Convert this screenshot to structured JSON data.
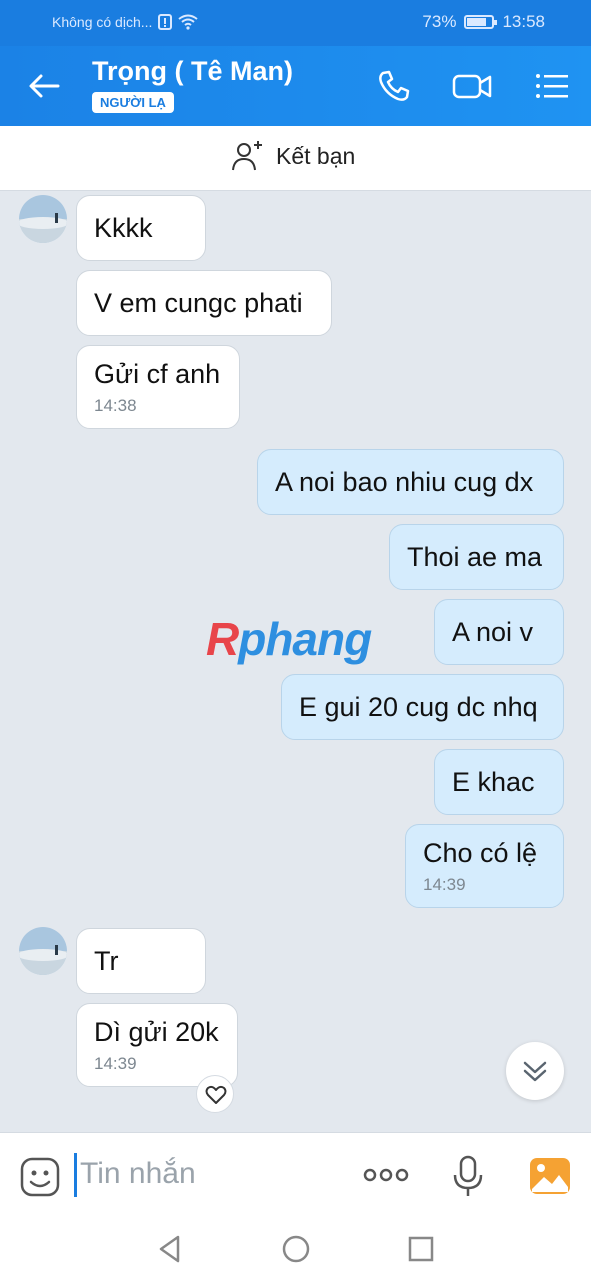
{
  "status_bar": {
    "carrier": "Không có dịch...",
    "battery": "73%",
    "battery_level": 0.73,
    "time": "13:58"
  },
  "header": {
    "title": "Trọng ( Tê Man)",
    "badge": "NGƯỜI LẠ",
    "icons": [
      "back-arrow-icon",
      "phone-icon",
      "video-call-icon",
      "menu-list-icon"
    ]
  },
  "add_friend": {
    "label": "Kết bạn",
    "icon": "add-user-icon"
  },
  "watermark": {
    "r": "R",
    "rest": "phang"
  },
  "messages": [
    {
      "dir": "in",
      "text": "Kkkk",
      "time": ""
    },
    {
      "dir": "in",
      "text": "V em cungc phati",
      "time": ""
    },
    {
      "dir": "in",
      "text": "Gửi cf anh",
      "time": "14:38"
    },
    {
      "dir": "out",
      "text": "A noi bao nhiu cug dx",
      "time": ""
    },
    {
      "dir": "out",
      "text": "Thoi ae ma",
      "time": ""
    },
    {
      "dir": "out",
      "text": "A noi v",
      "time": ""
    },
    {
      "dir": "out",
      "text": "E gui 20 cug dc nhq",
      "time": ""
    },
    {
      "dir": "out",
      "text": "E khac",
      "time": ""
    },
    {
      "dir": "out",
      "text": "Cho có lệ",
      "time": "14:39"
    },
    {
      "dir": "in",
      "text": "Tr",
      "time": ""
    },
    {
      "dir": "in",
      "text": "Dì gửi 20k",
      "time": "14:39"
    }
  ],
  "input": {
    "placeholder": "Tin nhắn",
    "icons": [
      "sticker-icon",
      "more-dots-icon",
      "microphone-icon",
      "image-icon"
    ]
  },
  "colors": {
    "accent": "#1a7de0",
    "outgoing_bubble": "#d5ecfd",
    "chat_bg": "#e3e8ee"
  }
}
